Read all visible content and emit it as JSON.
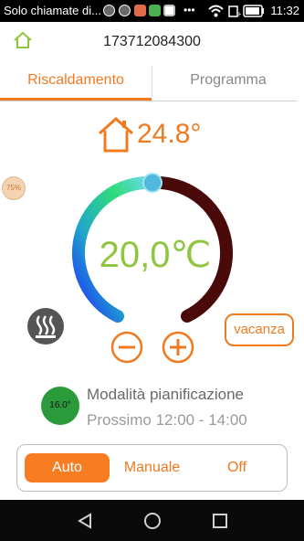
{
  "status_bar": {
    "notification_text": "Solo chiamate di...",
    "time": "11:32"
  },
  "header": {
    "device_id": "173712084300"
  },
  "tabs": [
    {
      "label": "Riscaldamento",
      "active": true
    },
    {
      "label": "Programma",
      "active": false
    }
  ],
  "thermostat": {
    "current_temp": "24.8°",
    "setpoint": "20,0℃",
    "badge": "75%"
  },
  "vacation": {
    "label": "vacanza"
  },
  "schedule": {
    "circle_temp": "16.0°",
    "title": "Modalità pianificazione",
    "next": "Prossimo 12:00 - 14:00"
  },
  "modes": [
    {
      "label": "Auto",
      "selected": true
    },
    {
      "label": "Manuale",
      "selected": false
    },
    {
      "label": "Off",
      "selected": false
    }
  ],
  "colors": {
    "accent": "#f07a20",
    "setpoint_text": "#8fc53f",
    "schedule_circle": "#2a9a3a"
  }
}
